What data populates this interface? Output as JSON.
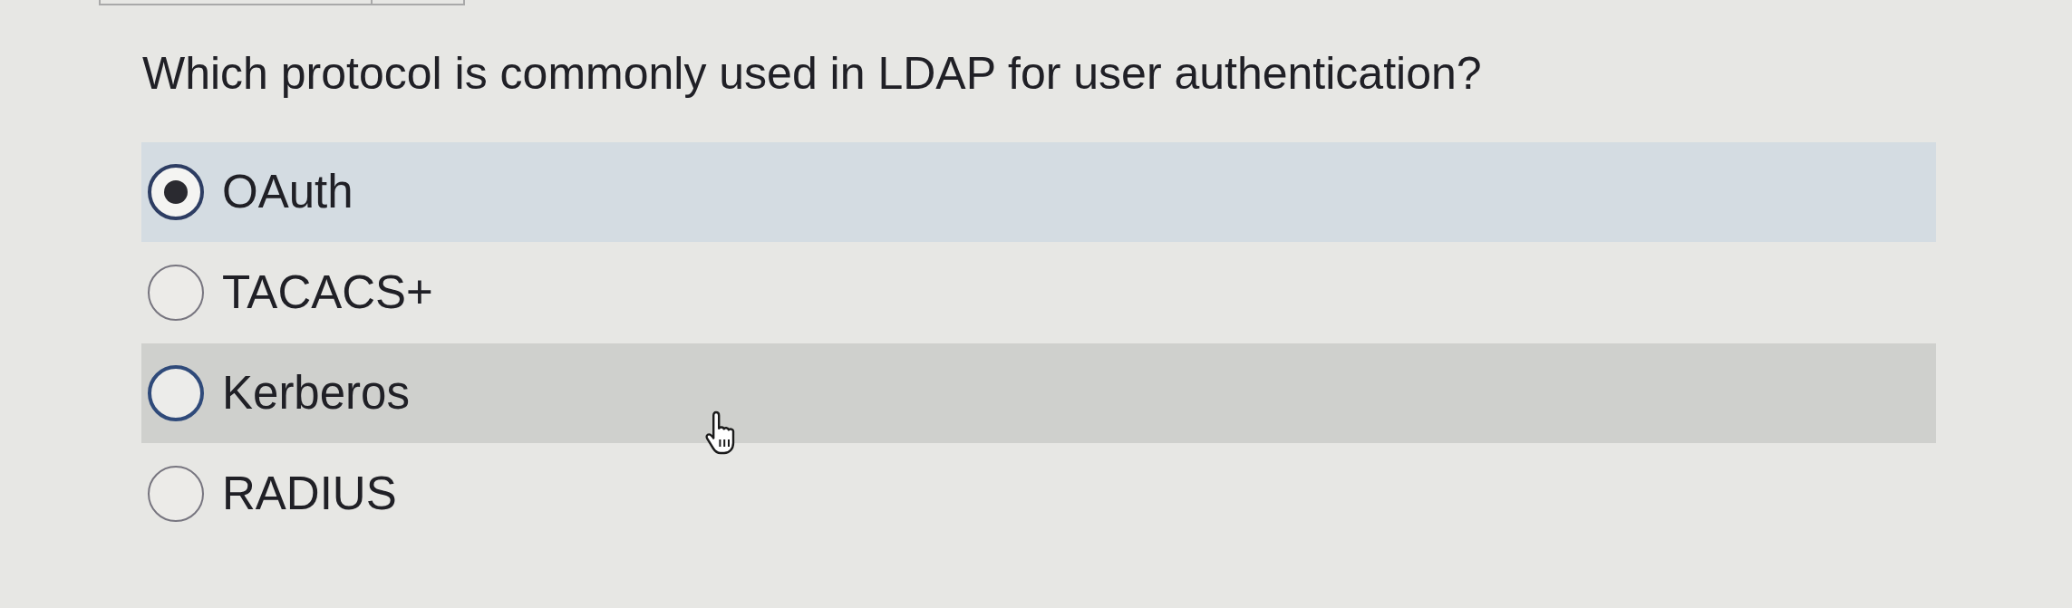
{
  "question": "Which protocol is commonly used in LDAP for user authentication?",
  "options": [
    {
      "label": "OAuth",
      "selected": true,
      "hovered": false
    },
    {
      "label": "TACACS+",
      "selected": false,
      "hovered": false
    },
    {
      "label": "Kerberos",
      "selected": false,
      "hovered": true
    },
    {
      "label": "RADIUS",
      "selected": false,
      "hovered": false
    }
  ]
}
